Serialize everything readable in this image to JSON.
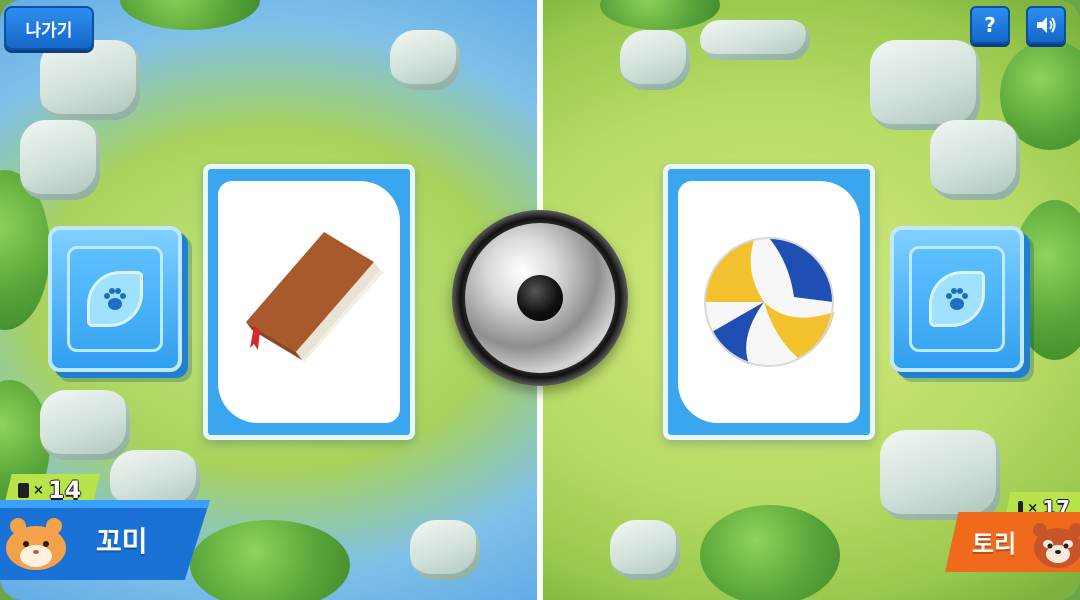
{
  "top_bar": {
    "exit_label": "나가기",
    "help_label": "?",
    "sound_icon": "speaker-icon"
  },
  "left_player": {
    "name": "꼬미",
    "card_count": "14",
    "count_prefix": "×",
    "avatar": "hamster-avatar",
    "banner_color": "#1a72d6"
  },
  "right_player": {
    "name": "토리",
    "card_count": "17",
    "count_prefix": "×",
    "avatar": "red-panda-avatar",
    "banner_color": "#f06a1c"
  },
  "board": {
    "left_card": "book-icon",
    "right_card": "volleyball-icon",
    "center": "bell-icon",
    "deck_icon": "paw-icon"
  },
  "colors": {
    "accent_blue": "#2d8ff0",
    "count_tag": "#b9e34a"
  }
}
